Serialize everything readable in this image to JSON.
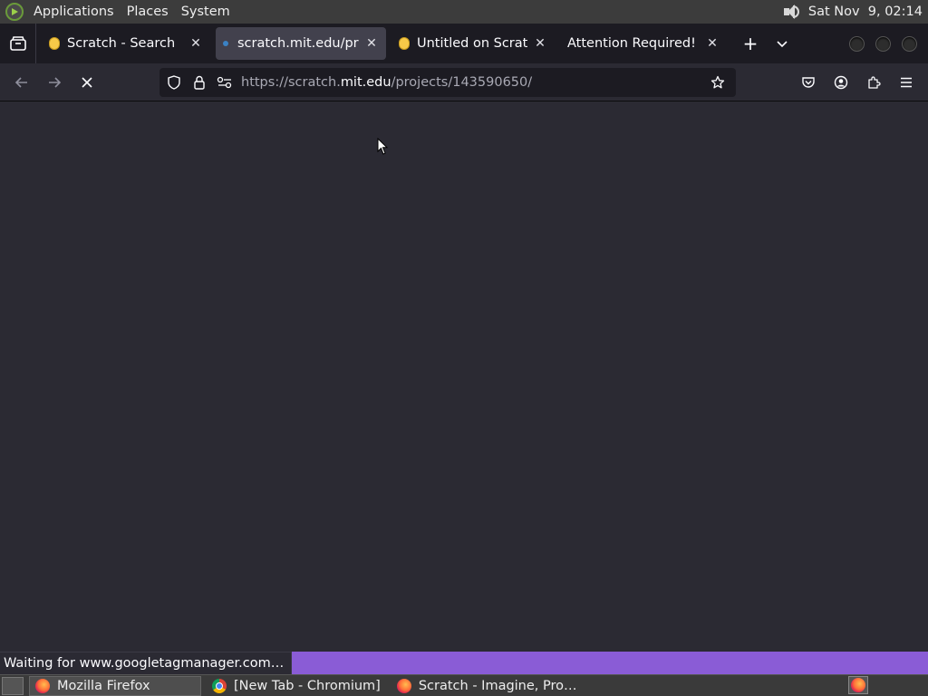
{
  "panel": {
    "menus": [
      "Applications",
      "Places",
      "System"
    ],
    "clock": "Sat Nov  9, 02:14"
  },
  "tabs": [
    {
      "title": "Scratch - Search",
      "icon": "scratch-favicon",
      "active": false
    },
    {
      "title": "scratch.mit.edu/proj",
      "icon": "loading-dot",
      "active": true
    },
    {
      "title": "Untitled on Scratch",
      "icon": "scratch-favicon",
      "active": false
    },
    {
      "title": "Attention Required! | Cl",
      "icon": "none",
      "active": false
    }
  ],
  "navbar": {
    "url_prefix": "https://scratch.",
    "url_host": "mit.edu",
    "url_suffix": "/projects/143590650/"
  },
  "status": {
    "text": "Waiting for www.googletagmanager.com…",
    "accent": "#8a5cd6"
  },
  "taskbar": {
    "items": [
      {
        "label": "Mozilla Firefox",
        "icon": "firefox-icon"
      },
      {
        "label": "[New Tab - Chromium]",
        "icon": "chromium-icon"
      },
      {
        "label": "Scratch - Imagine, Pro…",
        "icon": "firefox-icon"
      }
    ]
  }
}
